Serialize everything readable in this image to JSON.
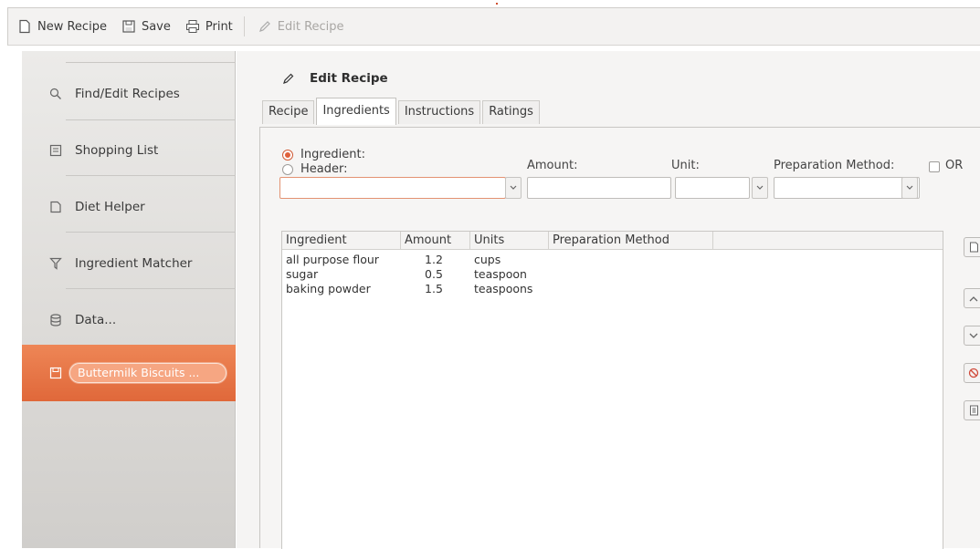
{
  "toolbar": {
    "new_recipe": "New Recipe",
    "save": "Save",
    "print": "Print",
    "edit_recipe": "Edit Recipe"
  },
  "sidebar": {
    "items": [
      {
        "label": "Find/Edit Recipes",
        "icon": "search-icon"
      },
      {
        "label": "Shopping List",
        "icon": "checklist-icon"
      },
      {
        "label": "Diet Helper",
        "icon": "page-icon"
      },
      {
        "label": "Ingredient Matcher",
        "icon": "funnel-icon"
      },
      {
        "label": "Data...",
        "icon": "database-icon"
      },
      {
        "label": "Buttermilk Biscuits ...",
        "icon": "recipe-card-icon",
        "active": true
      }
    ]
  },
  "editor": {
    "title": "Edit Recipe",
    "tabs": [
      {
        "label": "Recipe"
      },
      {
        "label": "Ingredients",
        "active": true
      },
      {
        "label": "Instructions"
      },
      {
        "label": "Ratings"
      }
    ],
    "form": {
      "ingredient_radio": "Ingredient:",
      "header_radio": "Header:",
      "amount_label": "Amount:",
      "unit_label": "Unit:",
      "prep_label": "Preparation Method:",
      "or_label": "OR",
      "ingredient_value": "",
      "amount_value": "",
      "unit_value": "",
      "prep_value": ""
    },
    "table": {
      "columns": [
        "Ingredient",
        "Amount",
        "Units",
        "Preparation Method"
      ],
      "rows": [
        {
          "ingredient": "all purpose flour",
          "amount": "1.2",
          "units": "cups",
          "prep": ""
        },
        {
          "ingredient": "sugar",
          "amount": "0.5",
          "units": "teaspoon",
          "prep": ""
        },
        {
          "ingredient": "baking powder",
          "amount": "1.5",
          "units": "teaspoons",
          "prep": ""
        }
      ]
    }
  },
  "colors": {
    "accent": "#e0683a",
    "sidebar_bg": "#dcdad7",
    "toolbar_bg": "#f3f2f1"
  }
}
